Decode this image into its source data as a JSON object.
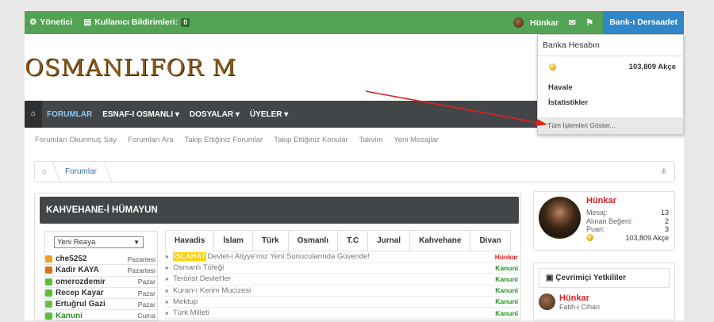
{
  "topbar": {
    "admin": "Yönetici",
    "notifications": "Kullanıcı Bildirimleri:",
    "notif_count": "0",
    "user": "Hünkar",
    "bank": "Bank-ı Dersaadet"
  },
  "logo": "OSMANLIFOR M",
  "nav": {
    "items": [
      "FORUMLAR",
      "ESNAF-I OSMANLI ▾",
      "DOSYALAR ▾",
      "ÜYELER ▾"
    ]
  },
  "subnav": [
    "Forumları Okunmuş Say",
    "Forumları Ara",
    "Takip Ettiğiniz Forumlar",
    "Takip Ettiğiniz Konular",
    "Takvim",
    "Yeni Mesajlar"
  ],
  "breadcrumb": "Forumlar",
  "section_title": "KAHVEHANE-İ HÜMAYUN",
  "select_value": "Yeni Reaya",
  "users": [
    {
      "name": "che5252",
      "day": "Pazartesi",
      "color": "#f0a020",
      "name_color": "#333"
    },
    {
      "name": "Kadir KAYA",
      "day": "Pazartesi",
      "color": "#e07020",
      "name_color": "#333"
    },
    {
      "name": "omerozdemir",
      "day": "Pazar",
      "color": "#5cbf3a",
      "name_color": "#333"
    },
    {
      "name": "Recep Kayar",
      "day": "Pazar",
      "color": "#5cbf3a",
      "name_color": "#333"
    },
    {
      "name": "Ertuğrul Gazi",
      "day": "Pazar",
      "color": "#6cc04a",
      "name_color": "#333"
    },
    {
      "name": "Kanuni",
      "day": "Cuma",
      "color": "#5cbf3a",
      "name_color": "#2a8f2a"
    }
  ],
  "tabs": [
    "Havadis",
    "İslam",
    "Türk",
    "Osmanlı",
    "T.C",
    "Jurnal",
    "Kahvehane",
    "Divan"
  ],
  "news": [
    {
      "tag": "ISLAHAT",
      "text": "Devlet-i Aliyye'miz Yeni Sunucularında Güvende!",
      "author": "Hünkar",
      "author_color": "#d22"
    },
    {
      "tag": "",
      "text": "Osmanlı Tüfeği",
      "author": "Kanuni",
      "author_color": "#2a8f2a"
    },
    {
      "tag": "",
      "text": "Terörist Devlet'ler",
      "author": "Kanuni",
      "author_color": "#2a8f2a"
    },
    {
      "tag": "",
      "text": "Kuran-ı Kerim Mucizesi",
      "author": "Kanuni",
      "author_color": "#2a8f2a"
    },
    {
      "tag": "",
      "text": "Mektup",
      "author": "Kanuni",
      "author_color": "#2a8f2a"
    },
    {
      "tag": "",
      "text": "Türk Milleti",
      "author": "Kanuni",
      "author_color": "#2a8f2a"
    }
  ],
  "profile": {
    "name": "Hünkar",
    "stats": [
      {
        "label": "Mesaj:",
        "value": "13"
      },
      {
        "label": "Alınan Beğeni:",
        "value": "2"
      },
      {
        "label": "Puan:",
        "value": "3"
      }
    ],
    "balance": "103,809 Akçe"
  },
  "online": {
    "title": "Çevrimiçi Yetkililer",
    "user": "Hünkar",
    "subtitle": "Fatih-i Cihan"
  },
  "dropdown": {
    "title": "Banka Hesabın",
    "balance": "103,809 Akçe",
    "links": [
      "Havale",
      "İstatistikler"
    ],
    "footer": "Tüm İşlemleri Göster..."
  },
  "colors": {
    "topbar": "#52a354",
    "bank": "#2f86c9",
    "nav": "#434648",
    "highlight": "#ffd400",
    "arrow": "#e02020"
  }
}
